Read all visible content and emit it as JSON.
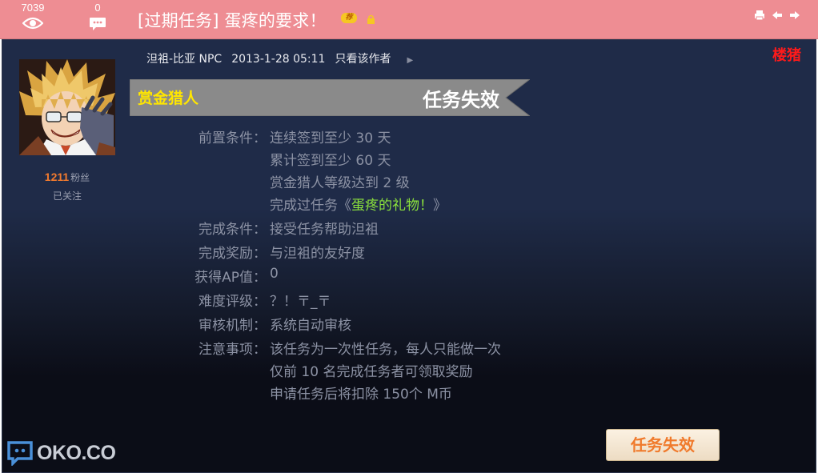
{
  "header": {
    "views": "7039",
    "comments": "0",
    "title": "[过期任务] 蛋疼的要求！",
    "badge": "荐",
    "icons": [
      "eye-icon",
      "comment-icon",
      "lock-icon",
      "print-icon",
      "prev-icon",
      "next-icon"
    ],
    "background": "#ee8d93"
  },
  "post": {
    "floor_label": "楼猪",
    "author": "泹袓-比亚 NPC",
    "date": "2013-1-28 05:11",
    "only_author": "只看该作者",
    "fans_count": "1211",
    "fans_label": "粉丝",
    "follow_status": "已关注",
    "banner_role": "赏金猎人",
    "banner_status": "任务失效",
    "rows": {
      "prereq_label": "前置条件：",
      "prereq": [
        "连续签到至少 30 天",
        "累计签到至少 60 天",
        "赏金猎人等级达到 2 级"
      ],
      "prereq_task_prefix": "完成过任务《",
      "prereq_task_link": "蛋疼的礼物！",
      "prereq_task_suffix": "》",
      "complete_label": "完成条件：",
      "complete": "接受任务帮助泹袓",
      "reward_label": "完成奖励：",
      "reward": "与泹袓的友好度",
      "ap_label": "获得AP值：",
      "ap": "0",
      "difficulty_label": "难度评级：",
      "difficulty": "？！〒_〒",
      "review_label": "审核机制：",
      "review": "系统自动审核",
      "notes_label": "注意事项：",
      "notes": [
        "该任务为一次性任务，每人只能做一次",
        "仅前 10 名完成任务者可领取奖励",
        "申请任务后将扣除 150个 M币"
      ]
    },
    "button_label": "任务失效",
    "watermark": "OKO.CO"
  },
  "colors": {
    "panel": "#1f2b48",
    "accent_orange": "#f07a2c",
    "banner_role": "#ffe600",
    "link_green": "#8be23c",
    "floor_red": "#ff1a1a"
  }
}
